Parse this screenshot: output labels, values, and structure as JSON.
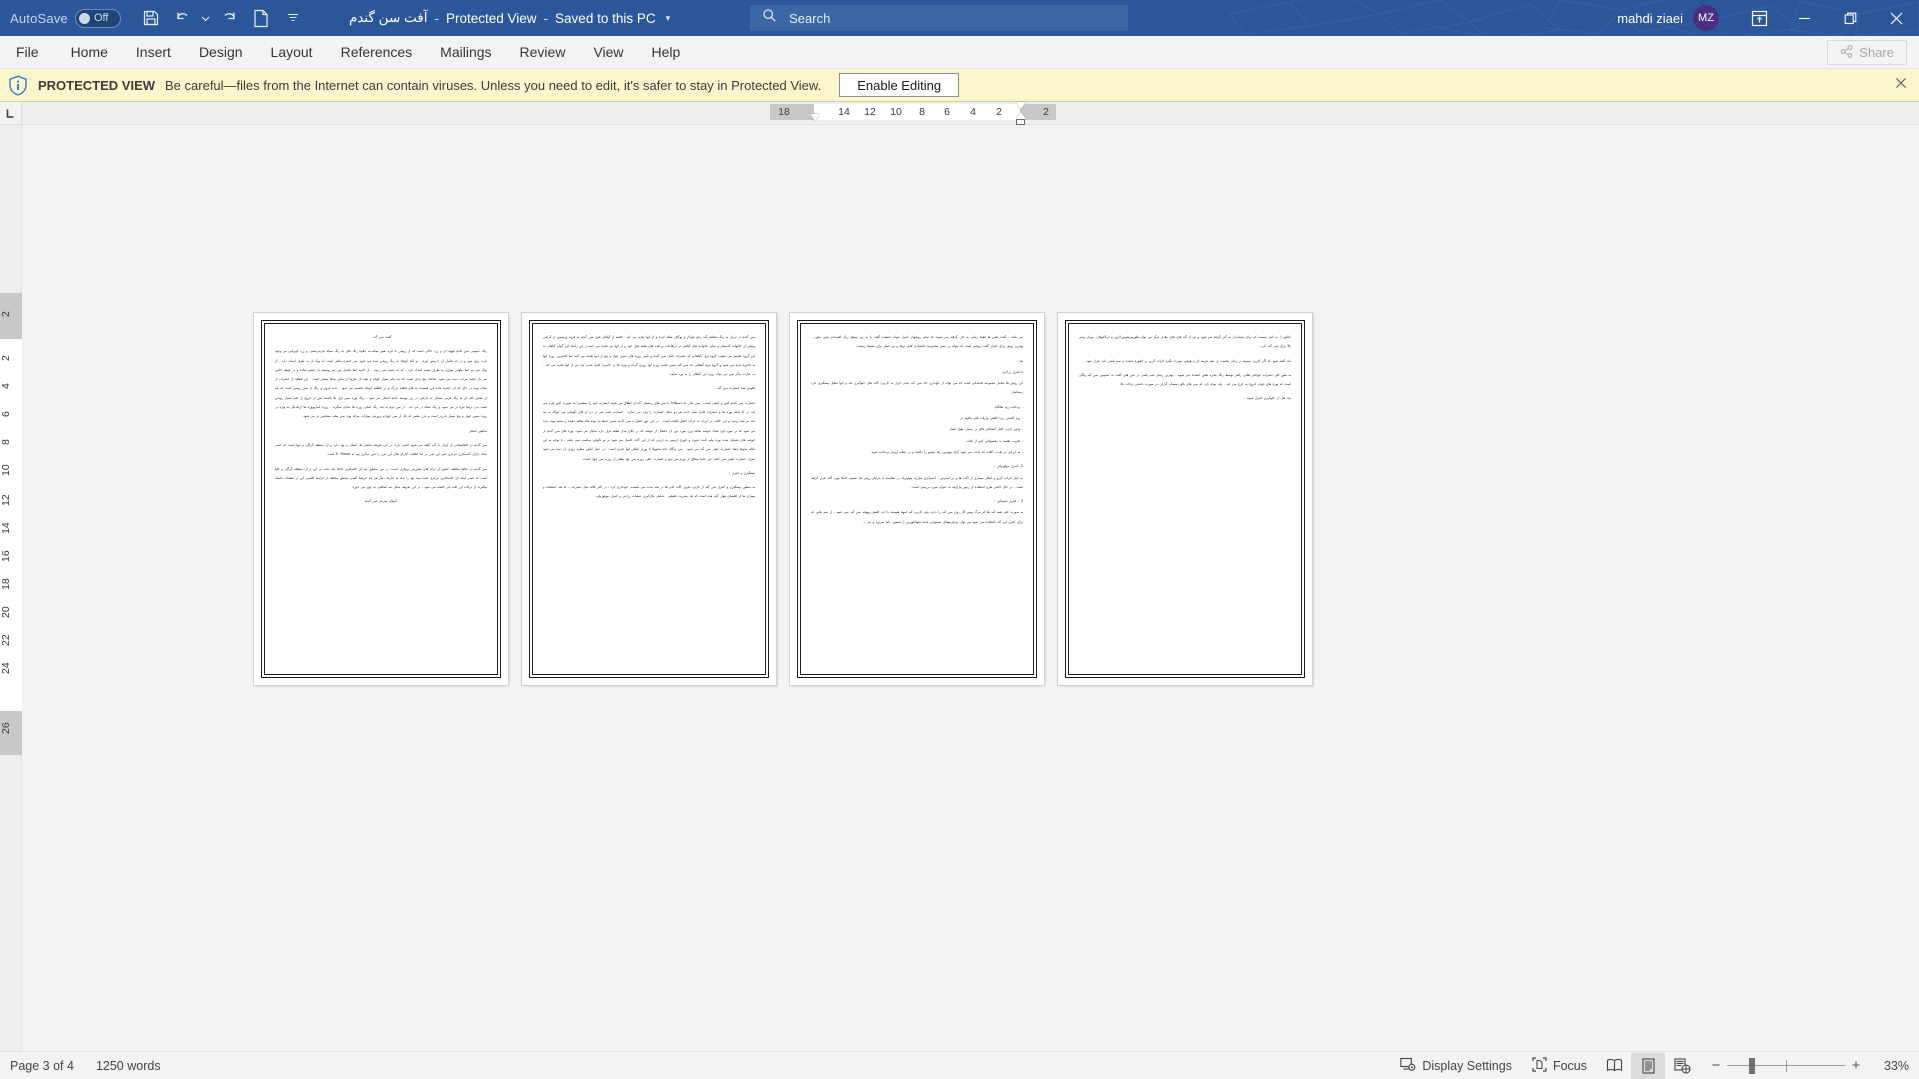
{
  "titlebar": {
    "autosave_label": "AutoSave",
    "autosave_state": "Off",
    "doc_name": "آفت سن گندم",
    "sep1": "-",
    "mode": "Protected View",
    "sep2": "-",
    "save_location": "Saved to this PC",
    "caret": "▾",
    "search_placeholder": "Search",
    "user_name": "mahdi ziaei",
    "user_initials": "MZ",
    "icons": {
      "save": "save-icon",
      "undo": "undo-icon",
      "undo_caret": "chevron-down-icon",
      "redo": "redo-icon",
      "new_doc": "new-document-icon",
      "qat_more": "quick-access-more-icon",
      "search": "search-icon",
      "ribbon_display": "ribbon-display-options-icon",
      "minimize": "minimize-icon",
      "restore": "restore-icon",
      "close": "close-icon"
    },
    "accent_color": "#2b579a",
    "avatar_color": "#4b2e83"
  },
  "ribbon": {
    "tabs": [
      {
        "label": "File"
      },
      {
        "label": "Home"
      },
      {
        "label": "Insert"
      },
      {
        "label": "Design"
      },
      {
        "label": "Layout"
      },
      {
        "label": "References"
      },
      {
        "label": "Mailings"
      },
      {
        "label": "Review"
      },
      {
        "label": "View"
      },
      {
        "label": "Help"
      }
    ],
    "share_label": "Share",
    "share_icon": "share-icon"
  },
  "protected_view": {
    "icon": "shield-info-icon",
    "title": "PROTECTED VIEW",
    "message": "Be careful—files from the Internet can contain viruses. Unless you need to edit, it's safer to stay in Protected View.",
    "button_label": "Enable Editing",
    "close_icon": "close-icon",
    "background": "#fdf6cc"
  },
  "ruler": {
    "tabstop_glyph": "L",
    "horizontal_numbers": [
      "18",
      "14",
      "12",
      "10",
      "8",
      "6",
      "4",
      "2",
      "2"
    ],
    "vertical_numbers": [
      "2",
      "2",
      "4",
      "6",
      "8",
      "10",
      "12",
      "14",
      "16",
      "18",
      "20",
      "22",
      "24",
      "26"
    ]
  },
  "document": {
    "pages": [
      {
        "number": 1,
        "paragraphs": [
          {
            "style": "center",
            "text": "گفت سن گند ."
          },
          {
            "style": "body",
            "text": "رنگ عمومی سن گندم قهوه ای و زرد خاکی است که از روشن تا تیره تغییر میکند.به علاوه رنگ های به رنگ سیاه ,قرمز,مسی و زرد کهربایی نیز وجود دارد. روی سپر و در حد فاصل ان با پیش لرزه , دو لکه کوچک به رنگ روشن دیده می شود. سر حشره مثلثی است که نوک ان به طرف امتداد دارد . از نوک سر دو خط طولی موازی به طرف سینه امتداد دارد . که به سینه نمی رسد . از ناحیه خط فاصل بین سر وسینه بار چشم ساده و در قوهه جانبی سر بار چشم مرکب دیده می شود. شاخک پنج بندی است که بند یکم بسیار کوتاه و بقیه ان تقریبا از سایر بندها بیشتر است . این قطعه از حشرات از ساده بوده در حال که ان حشره ماده این قسمت به های قطعه بزرگ و در قاطعه کوچک تقسیم می شود . غده کروی و رنگ از سپر روشن است که یله از مخش لکه ای به رنگ قرمز متمایل به نارنجی در زیر پوسته ناحیه اسکار می شود . رنگ پوره ممن اول بلا فاصله پس از خروج از تخم بسیار روشن است بدن تریجا تیره تر می شود و رنگ سیاه در می اید . از سن دوم به بعد رنگ اصلی روره ها نمایان میگردد . روره کماریووره ها ازیکدیگر به ویژه در روره سنین چهار و پنج بسیار بارزتر است و بارز مخص له بال از سن چهارم پرورش موازات مزائد بوی سن پنجم مشخص تر می شود."
          },
          {
            "style": "head",
            "text": "مناطق انتشار"
          },
          {
            "style": "body",
            "text": "سن گندم در افغانستانی از ایران تا گت گفته می شود حلمی دارد. در این تعریف شامل یک استان و بود دارد و ان منطقه گرگان و تنها است که خصر اینکه دارای گندمکاری مزکزی امی این سن در اینا اهالیت ادارای های این سن را سن دیگری بود به E. Maura است."
          },
          {
            "style": "body",
            "text": "سن گندم در نقاط مختلف کشور از ترک های متاورش بروفرار است. در بین مناطق تپه ای خاصلتری جانفا باید دقت بر این و ان منطقه گرگان و کلیا است که خصر اینکه ای خانمانکری مرکزی است مید بود را شاد به خارجه دیگر هر چه خرایط الیمی مناطق مختلف از فرایط اقلیمی این در قطعات فاصله میگیرند از ترکات این افت لیز کاسته می شود . در این تعریف شکل تیه اسکلیی به چهر می خورد."
          },
          {
            "style": "center",
            "text": "گرهان میزبان سن گندم"
          }
        ]
      },
      {
        "number": 2,
        "paragraphs": [
          {
            "style": "body",
            "text": "سن گندم در ایران به رنگ مختلف گند رخو چوادار و پوگاف معله کرده و از انها تغذیه می کند . قلعیه از گیاهان قوی سن گندم به قروه ورسیس از گرامی وبعض از خاکواده گندمیان و سایر خانواده های گیاهی در ارتفاعات و تعدد های هفته های خود و از انها نیز تغذیه می کنند.در این راستا این گوان گیاهان به این گروه تقسیم می شوند: گروه اول ,گیاهانی که حشرات کامل سن گندم و نامی روره های سنین چهار و پنج از انها تغذیه می کنند اما انخمرزن روره انها به تاخیره دیده می شود و گروه دوم گیاهانی که سن گند ضمن تغذیه روره انها روزی گرده و پوره ها در حاصره کامل شدن چند نیز از انها تغذیه می کند . به عبارت دیگر سن می تواند روره این گیاهان را به ورد نمایید."
          },
          {
            "style": "head",
            "text": "فعودی هند خسارت سن گند ."
          },
          {
            "style": "body",
            "text": "خسارت سن گندم کس و کیفی است . سن مادر که اصطلاحا با سن های زمستان گذران اطلاق می شود خسارت خود را منحصرا به صورت کس وارد می کند در جا اینکه پوره ها و حشرات کامل نسل جدید هر دو شکل خسارت را وارد می سازند . خسارت کمی منز در دن از های نگهبانی می کواکد به مه شد مر شد پرسد و این حالت در ایران به کرات اتفاق افتاده است . در این نوع خسارت سن گندم ضمن حمله به بوته هاه ساقه دهنده و ضمه بوته دیده می شود که در مورد اول تعداد خوشه ساقه ورن مورد دور ان خسائل از خوشه که در بالای مدل لطفه قرار دارد نمایان می شود. پوره های سن گندم از خوشه های تشکیل شده نوره ولید گنده عنوره و خوری ارتیمی به ارزنی که از این گات حاصل می شود بر تو تالوایی مناسب نمی باشد . با توجه به این نکاته مذوقه ابعاد خسارت کیفی سن گند می شود . سن ژنگال دانه محوولا با بوری کیفلی انها حمزه است . در عمل لیاهن مطره روزی ان دیده می شود میزان خسارت کیفی سن کامل غیر جانبا بیطاق از پوره سن پنج و خسارت کیفی روره سن پنچ بیفلتر از روره سن چهار است."
          },
          {
            "style": "head",
            "text": "پیشگیری و کنترل :"
          },
          {
            "style": "body",
            "text": "به منظور پیشگیری و کنترل سن گند از کاربرد ماوی, اگت کلی ها در بلند مدت می بایست, خودداری کرد . در اکثر کلاند مثل حشرات – که هد. استفاده و بیماری ها از اقلیمای هول گاید هده است که یک مدیریت تلفیقی , شامل بکارگیری عملیات زراعی و کنترل بیولوژیکی."
          }
        ]
      },
      {
        "number": 3,
        "paragraphs": [
          {
            "style": "body",
            "text": "می باشد . گفت نقص ها فقط زمانی به غاز ,گرفته می شوند که سایر روشهای کنترل نتواند جمعیت گفت را به زیر سطح زیان اقتصادی پایین بیاورد . بهترین روش برای کنترل گفت روشی است که بتواند پر مبنی محدودیت اقتصادی قابل دوام و پی خطر برای محیط زیست."
          },
          {
            "style": "head",
            "text": "بعد ."
          },
          {
            "style": "head",
            "text": "1-کنترل زراعی:"
          },
          {
            "style": "body",
            "text": "این روش ها شامل مجموعه اقداماتی است که می تواند از نگهداری جاد سن گند بکدن ابزار به کاربرد, گاند های جلوگیری کند و انها تقلیل پیشگیری دارد رمشامل:"
          },
          {
            "style": "body",
            "text": "- پرداخت زود هانگام"
          },
          {
            "style": "body",
            "text": "- زود کاشتن ریزا کاهش وارپانه های ماقوم تر"
          },
          {
            "style": "body",
            "text": "- وجین کردن کامل اقضایای های در ضمان طول فصل"
          },
          {
            "style": "body",
            "text": "- تخریب تقعمد با محصولاتی کثیر از اقات"
          },
          {
            "style": "body",
            "text": "- به ارزانی در تفدت اگفت که باعث می شود گراه بیهترین رهد واصو را داشته و در نتیجه ازودتر پرداخت شود."
          },
          {
            "style": "head",
            "text": "2- کنترل بیولوژیکی :"
          },
          {
            "style": "body",
            "text": "به دلیل اثرات گزرو و اهکار بسیاری از اگت ها و بر استرس , استراتژی مبارزه بیولوژیک در مقایسه با مزایای روش ها, همیتی کاملا مورد اگند قرار گرفته است . در حال حاضر طرح استفاده از زنبور پارازیته به عنوان مورد بررسی است."
          },
          {
            "style": "head",
            "text": "3 – کنترل شیمیایی :"
          },
          {
            "style": "body",
            "text": "به صورت کلی همه گند ها اثر مرگ ومیر گار روی سن گند را دارند ولی کاربرد گند لمهبا همیشه با اعد کاهش وبهجه سن گند نمی شود , از سم هایی که برای کنترل این گند استفاده می شود می توان پیرفریتوهای مصنوعی ماننه فنواکلوپرین ( دسیس- دلتا مترین) و نیز ..."
          }
        ]
      },
      {
        "number": 4,
        "paragraphs": [
          {
            "style": "body",
            "text": "دکتاون ) به دلیل سمیت کم برای پستادران به گتر گرفته می شود و نیز از گند های های مقدار دیگر می توان هلورپیریفوس,اکرو, و ترکاکوهای, میزان ومی بالا برای سن گند دارد ."
          },
          {
            "style": "body",
            "text": "باید گفته شود که اگر کاربرد سموم در زمان مناسب از نظر هزینه ای و هوایی صورت نگیرد اثرات گزرو بر انجوزه داشت و سم پاشی باید تکرار شود ."
          },
          {
            "style": "body",
            "text": "به طور کلی حشرات کوچکتر هلایی راهتر توسط رنگ مخره نقش کشنده می شوند . بهترین زیمان سم پاشی در سن های گفت به خصوص سن گند ولگی است که پوره های جوان خروج به خرج می کند . باید توجه کرد که سن های بالغ زمستان گذران در صورت داشتن ترکات بالا."
          },
          {
            "style": "body",
            "text": "باید قبل از جلوگیری کنترل شوند ."
          }
        ]
      }
    ]
  },
  "statusbar": {
    "page_info": "Page 3 of 4",
    "word_count": "1250 words",
    "display_settings_label": "Display Settings",
    "display_settings_icon": "display-settings-icon",
    "focus_label": "Focus",
    "focus_icon": "focus-icon",
    "view_read_icon": "read-mode-icon",
    "view_print_icon": "print-layout-icon",
    "view_web_icon": "web-layout-icon",
    "zoom_out": "−",
    "zoom_in": "+",
    "zoom_level": "33%"
  }
}
